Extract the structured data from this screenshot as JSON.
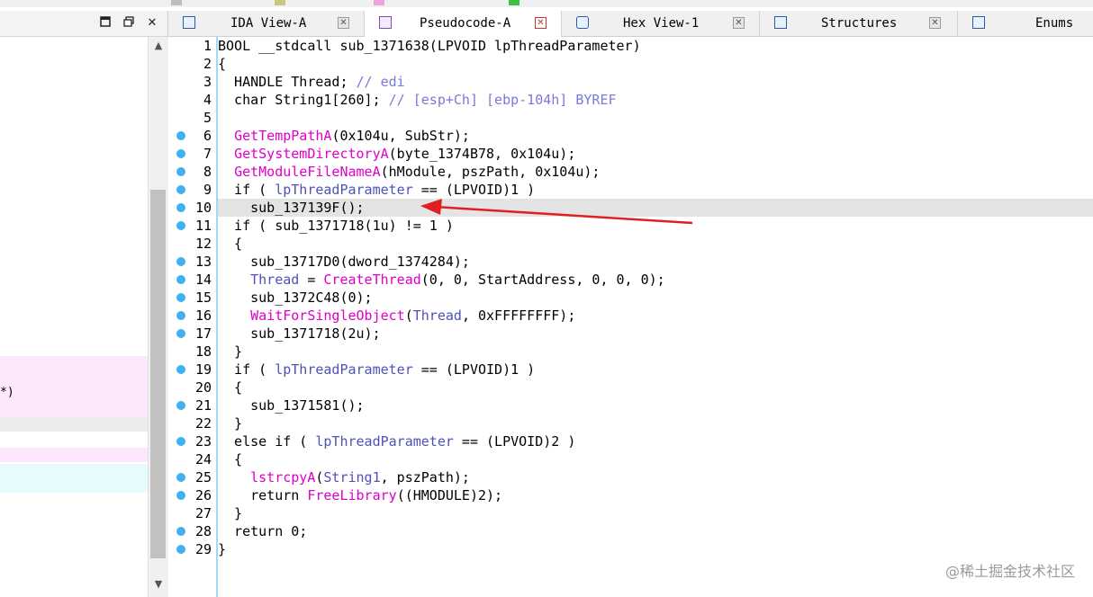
{
  "colors": {
    "keyword": "#000000",
    "function": "#e000c8",
    "variable": "#5050b8",
    "comment": "#7a7ad8",
    "constant": "#000000",
    "dot": "#3fb0f0",
    "arrow": "#e02020"
  },
  "left_panel": {
    "text_fragment": "*)",
    "buttons": {
      "restore_icon": "square-icon",
      "maximize_icon": "windows-icon",
      "close": "✕"
    },
    "scroll_up": "▲",
    "scroll_down": "▼"
  },
  "tabs": [
    {
      "label": "IDA View-A",
      "icon": "ida-view-icon",
      "active": false
    },
    {
      "label": "Pseudocode-A",
      "icon": "pseudocode-icon",
      "active": true
    },
    {
      "label": "Hex View-1",
      "icon": "hex-view-icon",
      "active": false
    },
    {
      "label": "Structures",
      "icon": "structures-icon",
      "active": false
    },
    {
      "label": "Enums",
      "icon": "enums-icon",
      "active": false
    }
  ],
  "code": {
    "highlighted_line": 10,
    "lines": [
      {
        "n": "1",
        "dot": false,
        "tokens": [
          [
            "BOOL __stdcall sub_1371638(LPVOID lpThreadParameter)",
            "k"
          ]
        ]
      },
      {
        "n": "2",
        "dot": false,
        "tokens": [
          [
            "{",
            "k"
          ]
        ]
      },
      {
        "n": "3",
        "dot": false,
        "tokens": [
          [
            "  HANDLE Thread; ",
            "k"
          ],
          [
            "// edi",
            "c"
          ]
        ]
      },
      {
        "n": "4",
        "dot": false,
        "tokens": [
          [
            "  char String1[260]; ",
            "k"
          ],
          [
            "// [esp+Ch] [ebp-104h] BYREF",
            "c"
          ]
        ]
      },
      {
        "n": "5",
        "dot": false,
        "tokens": [
          [
            "",
            "k"
          ]
        ]
      },
      {
        "n": "6",
        "dot": true,
        "tokens": [
          [
            "  ",
            "k"
          ],
          [
            "GetTempPathA",
            "f"
          ],
          [
            "(0x104u, SubStr);",
            "k"
          ]
        ]
      },
      {
        "n": "7",
        "dot": true,
        "tokens": [
          [
            "  ",
            "k"
          ],
          [
            "GetSystemDirectoryA",
            "f"
          ],
          [
            "(byte_1374B78, 0x104u);",
            "k"
          ]
        ]
      },
      {
        "n": "8",
        "dot": true,
        "tokens": [
          [
            "  ",
            "k"
          ],
          [
            "GetModuleFileNameA",
            "f"
          ],
          [
            "(hModule, pszPath, 0x104u);",
            "k"
          ]
        ]
      },
      {
        "n": "9",
        "dot": true,
        "tokens": [
          [
            "  if ( ",
            "k"
          ],
          [
            "lpThreadParameter",
            "v"
          ],
          [
            " == (LPVOID)1 )",
            "k"
          ]
        ]
      },
      {
        "n": "10",
        "dot": true,
        "tokens": [
          [
            "    sub_137139F();",
            "k"
          ]
        ]
      },
      {
        "n": "11",
        "dot": true,
        "tokens": [
          [
            "  if ( sub_1371718(1u) != 1 )",
            "k"
          ]
        ]
      },
      {
        "n": "12",
        "dot": false,
        "tokens": [
          [
            "  {",
            "k"
          ]
        ]
      },
      {
        "n": "13",
        "dot": true,
        "tokens": [
          [
            "    sub_13717D0(dword_1374284);",
            "k"
          ]
        ]
      },
      {
        "n": "14",
        "dot": true,
        "tokens": [
          [
            "    ",
            "k"
          ],
          [
            "Thread",
            "v"
          ],
          [
            " = ",
            "k"
          ],
          [
            "CreateThread",
            "f"
          ],
          [
            "(0, 0, StartAddress, 0, 0, 0);",
            "k"
          ]
        ]
      },
      {
        "n": "15",
        "dot": true,
        "tokens": [
          [
            "    sub_1372C48(0);",
            "k"
          ]
        ]
      },
      {
        "n": "16",
        "dot": true,
        "tokens": [
          [
            "    ",
            "k"
          ],
          [
            "WaitForSingleObject",
            "f"
          ],
          [
            "(",
            "k"
          ],
          [
            "Thread",
            "v"
          ],
          [
            ", 0xFFFFFFFF);",
            "k"
          ]
        ]
      },
      {
        "n": "17",
        "dot": true,
        "tokens": [
          [
            "    sub_1371718(2u);",
            "k"
          ]
        ]
      },
      {
        "n": "18",
        "dot": false,
        "tokens": [
          [
            "  }",
            "k"
          ]
        ]
      },
      {
        "n": "19",
        "dot": true,
        "tokens": [
          [
            "  if ( ",
            "k"
          ],
          [
            "lpThreadParameter",
            "v"
          ],
          [
            " == (LPVOID)1 )",
            "k"
          ]
        ]
      },
      {
        "n": "20",
        "dot": false,
        "tokens": [
          [
            "  {",
            "k"
          ]
        ]
      },
      {
        "n": "21",
        "dot": true,
        "tokens": [
          [
            "    sub_1371581();",
            "k"
          ]
        ]
      },
      {
        "n": "22",
        "dot": false,
        "tokens": [
          [
            "  }",
            "k"
          ]
        ]
      },
      {
        "n": "23",
        "dot": true,
        "tokens": [
          [
            "  else if ( ",
            "k"
          ],
          [
            "lpThreadParameter",
            "v"
          ],
          [
            " == (LPVOID)2 )",
            "k"
          ]
        ]
      },
      {
        "n": "24",
        "dot": false,
        "tokens": [
          [
            "  {",
            "k"
          ]
        ]
      },
      {
        "n": "25",
        "dot": true,
        "tokens": [
          [
            "    ",
            "k"
          ],
          [
            "lstrcpyA",
            "f"
          ],
          [
            "(",
            "k"
          ],
          [
            "String1",
            "v"
          ],
          [
            ", pszPath);",
            "k"
          ]
        ]
      },
      {
        "n": "26",
        "dot": true,
        "tokens": [
          [
            "    return ",
            "k"
          ],
          [
            "FreeLibrary",
            "f"
          ],
          [
            "((HMODULE)2);",
            "k"
          ]
        ]
      },
      {
        "n": "27",
        "dot": false,
        "tokens": [
          [
            "  }",
            "k"
          ]
        ]
      },
      {
        "n": "28",
        "dot": true,
        "tokens": [
          [
            "  return 0;",
            "k"
          ]
        ]
      },
      {
        "n": "29",
        "dot": true,
        "tokens": [
          [
            "}",
            "k"
          ]
        ]
      }
    ]
  },
  "watermark": "@稀土掘金技术社区"
}
